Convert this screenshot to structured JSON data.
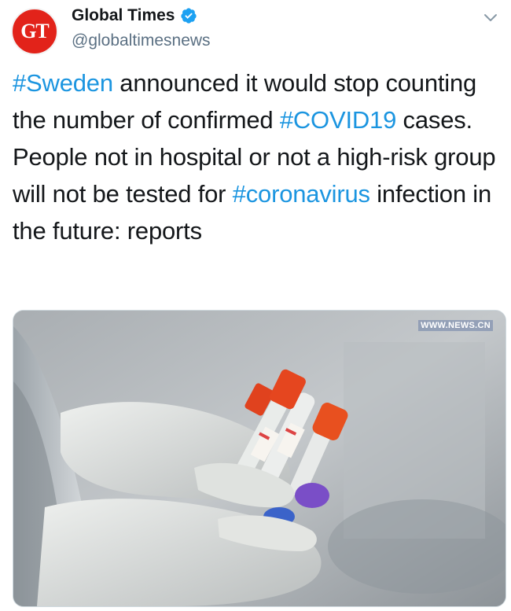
{
  "account": {
    "avatar_letters": "GT",
    "display_name": "Global Times",
    "handle": "@globaltimesnews",
    "verified": true
  },
  "tweet": {
    "segments": [
      {
        "text": "#Sweden",
        "type": "hashtag"
      },
      {
        "text": " announced it would stop counting the number of confirmed ",
        "type": "text"
      },
      {
        "text": "#COVID19",
        "type": "hashtag"
      },
      {
        "text": " cases. People not in hospital or not a high-risk group will not be tested for ",
        "type": "text"
      },
      {
        "text": "#coronavirus",
        "type": "hashtag"
      },
      {
        "text": " infection in the future: reports",
        "type": "text"
      }
    ]
  },
  "media": {
    "watermark": "WWW.NEWS.CN",
    "image_icon": "photo-test-tubes-gloved-hands"
  },
  "icons": {
    "verified": "verified-badge-icon",
    "more": "chevron-down-icon"
  },
  "colors": {
    "hashtag": "#1b95e0",
    "verified": "#1da1f2",
    "avatar_bg": "#e2231a",
    "handle": "#5b7083"
  }
}
